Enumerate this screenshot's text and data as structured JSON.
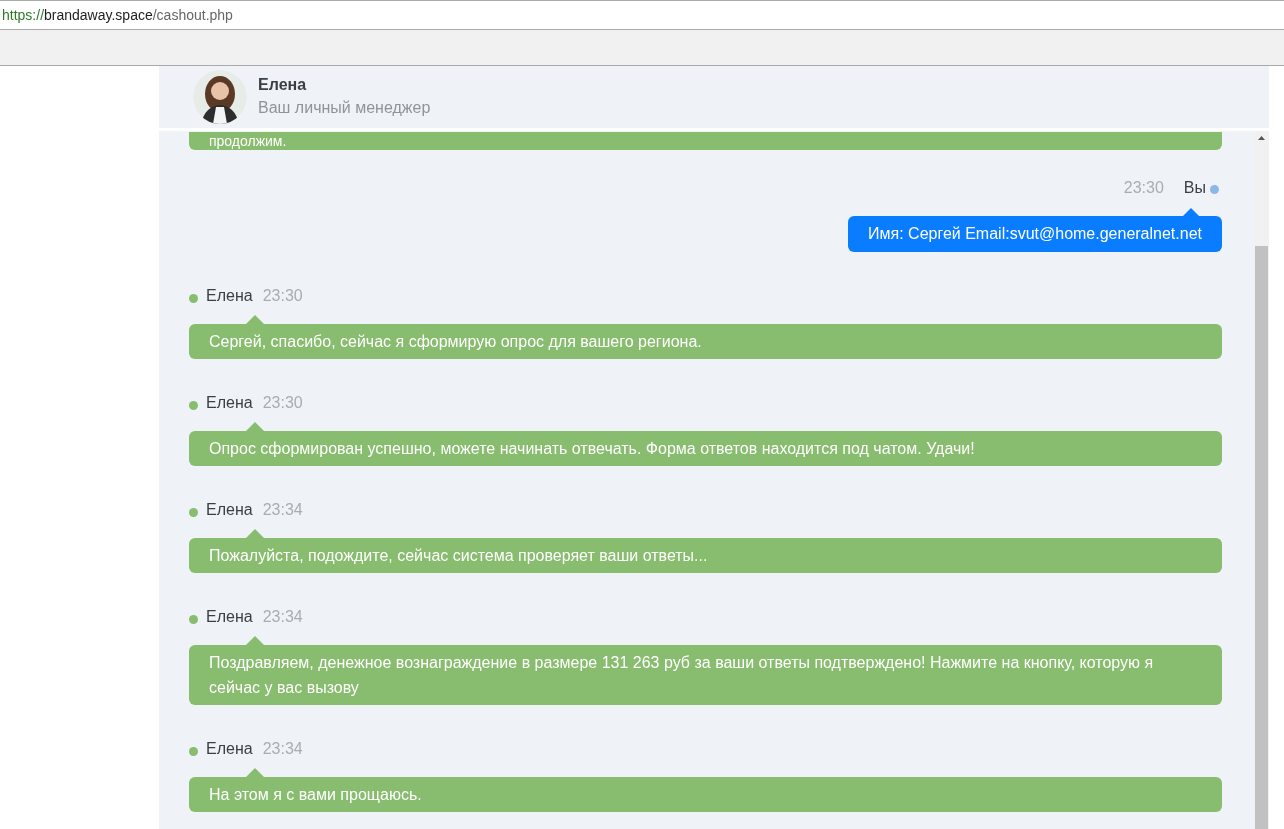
{
  "browser": {
    "url_scheme": "https://",
    "url_host": "brandaway.space",
    "url_path": "/cashout.php"
  },
  "chat_header": {
    "name": "Елена",
    "subtitle": "Ваш личный менеджер"
  },
  "messages": [
    {
      "kind": "continued",
      "text": "продолжим."
    },
    {
      "kind": "user",
      "sender": "Вы",
      "time": "23:30",
      "text": "Имя: Сергей Email:svut@home.generalnet.net"
    },
    {
      "kind": "manager",
      "sender": "Елена",
      "time": "23:30",
      "text": "Сергей, спасибо, сейчас я сформирую опрос для вашего региона."
    },
    {
      "kind": "manager",
      "sender": "Елена",
      "time": "23:30",
      "text": "Опрос сформирован успешно, можете начинать отвечать. Форма ответов находится под чатом. Удачи!"
    },
    {
      "kind": "manager",
      "sender": "Елена",
      "time": "23:34",
      "text": "Пожалуйста, подождите, сейчас система проверяет ваши ответы..."
    },
    {
      "kind": "manager",
      "sender": "Елена",
      "time": "23:34",
      "text": "Поздравляем, денежное вознаграждение в размере 131 263 руб за ваши ответы подтверждено! Нажмите на кнопку, которую я сейчас у вас вызову"
    },
    {
      "kind": "manager",
      "sender": "Елена",
      "time": "23:34",
      "text": "На этом я с вами прощаюсь."
    }
  ]
}
